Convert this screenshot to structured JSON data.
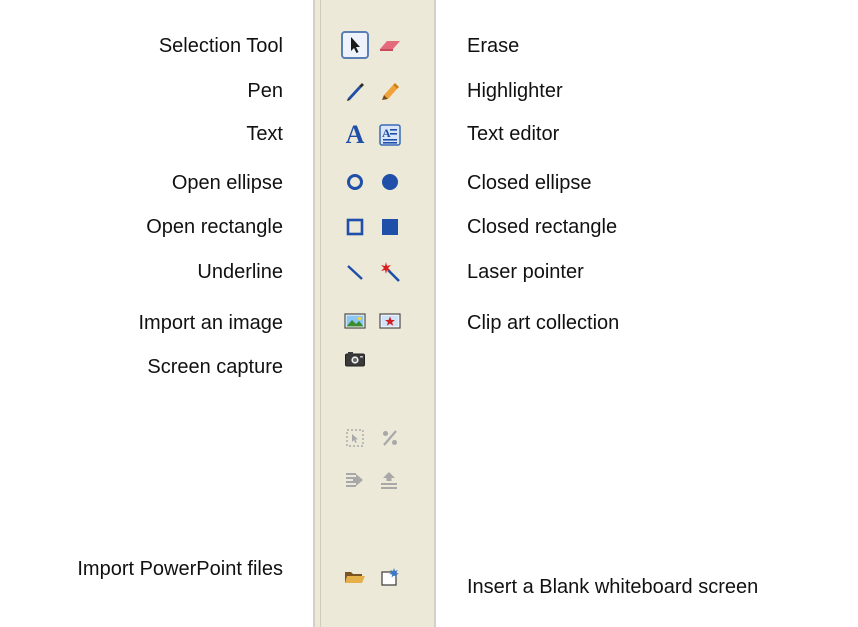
{
  "left_labels": [
    "Selection Tool",
    "Pen",
    "Text",
    "Open ellipse",
    "Open rectangle",
    "Underline",
    "Import an image",
    "Screen capture",
    "Import PowerPoint files"
  ],
  "right_labels": [
    "Erase",
    "Highlighter",
    "Text editor",
    "Closed ellipse",
    "Closed rectangle",
    "Laser pointer",
    "Clip art collection",
    "Insert a Blank whiteboard screen"
  ],
  "toolbar": {
    "selected_tool": "selection-tool-icon",
    "text_glyph": "A",
    "background": "#ece9d8",
    "accent": "#1f4fa8",
    "disabled": "#a8a8a8"
  }
}
